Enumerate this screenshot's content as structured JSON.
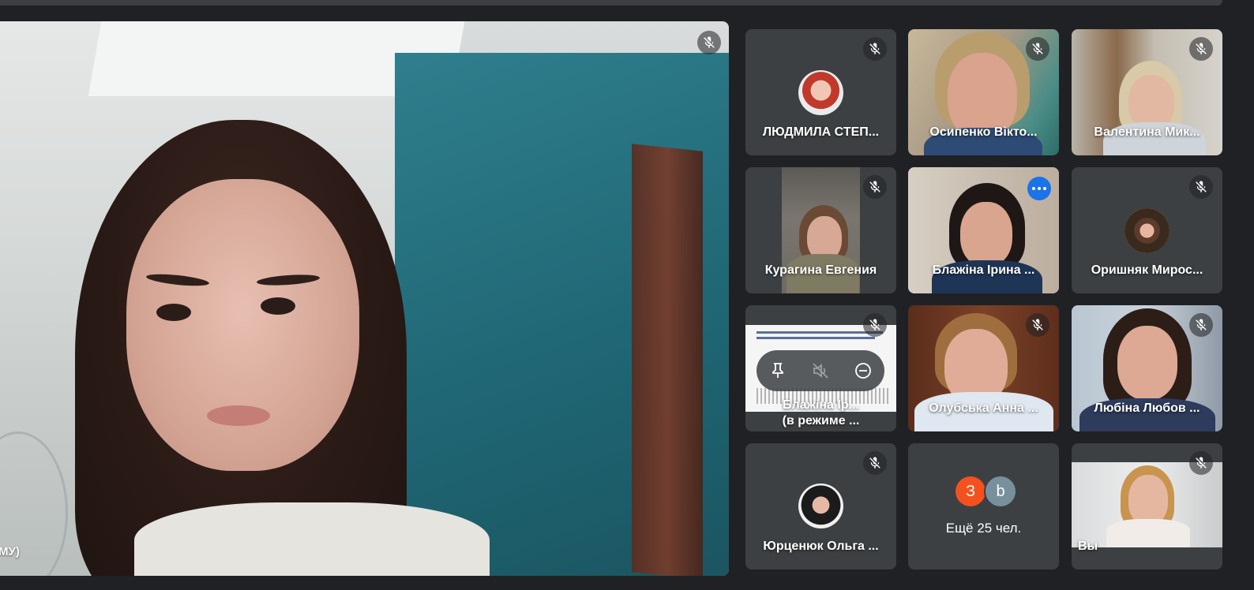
{
  "main": {
    "name_fragment": "МУ)"
  },
  "participants": [
    {
      "name": "ЛЮДМИЛА СТЕП..."
    },
    {
      "name": "Осипенко Вікто..."
    },
    {
      "name": "Валентина Мик..."
    },
    {
      "name": "Курагина Евгения"
    },
    {
      "name": "Блажіна Ірина ..."
    },
    {
      "name": "Оришняк Мирос..."
    },
    {
      "name": "Блажіна Ір...",
      "subtitle": "(в режиме ..."
    },
    {
      "name": "Олубська Анна ..."
    },
    {
      "name": "Любіна Любов ..."
    },
    {
      "name": "Юрценюк Ольга ..."
    },
    {
      "name": "Вы"
    }
  ],
  "more": {
    "initial_1": "З",
    "initial_2": "b",
    "text": "Ещё 25 чел.",
    "color_1": "#f4511e",
    "color_2": "#78909c"
  },
  "colors": {
    "background": "#202124",
    "tile": "#3c4043",
    "active_outline": "#8ab4f8",
    "accent": "#1a73e8"
  },
  "icons": {
    "mic_off": "mic-off-icon",
    "pin": "pin-icon",
    "mute": "volume-off-icon",
    "remove": "remove-icon",
    "more": "more-options-icon"
  }
}
